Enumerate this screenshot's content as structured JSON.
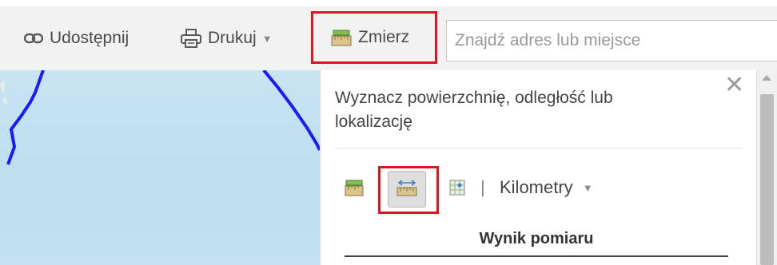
{
  "toolbar": {
    "share_label": "Udostępnij",
    "print_label": "Drukuj",
    "measure_label": "Zmierz",
    "search_placeholder": "Znajdź adres lub miejsce"
  },
  "panel": {
    "description": "Wyznacz powierzchnię, odległość lub lokalizację",
    "unit_separator": "|",
    "unit_selected": "Kilometry",
    "result_title": "Wynik pomiaru"
  },
  "icons": {
    "share": "link-icon",
    "print": "printer-icon",
    "measure": "measure-area-icon",
    "close": "close-icon",
    "area_tool": "area-measure-icon",
    "distance_tool": "distance-measure-icon",
    "location_tool": "location-measure-icon"
  },
  "colors": {
    "highlight": "#e0141e",
    "map_water": "#c4e0f1",
    "boundary_line": "#1a1aff",
    "toolbar_bg": "#f2f2f2"
  }
}
